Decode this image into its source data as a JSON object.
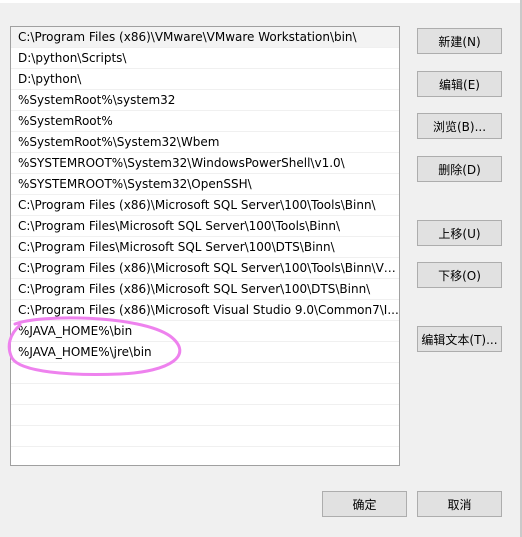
{
  "path_list": {
    "entries": [
      "C:\\Program Files (x86)\\VMware\\VMware Workstation\\bin\\",
      "D:\\python\\Scripts\\",
      "D:\\python\\",
      "%SystemRoot%\\system32",
      "%SystemRoot%",
      "%SystemRoot%\\System32\\Wbem",
      "%SYSTEMROOT%\\System32\\WindowsPowerShell\\v1.0\\",
      "%SYSTEMROOT%\\System32\\OpenSSH\\",
      "C:\\Program Files (x86)\\Microsoft SQL Server\\100\\Tools\\Binn\\",
      "C:\\Program Files\\Microsoft SQL Server\\100\\Tools\\Binn\\",
      "C:\\Program Files\\Microsoft SQL Server\\100\\DTS\\Binn\\",
      "C:\\Program Files (x86)\\Microsoft SQL Server\\100\\Tools\\Binn\\VS...",
      "C:\\Program Files (x86)\\Microsoft SQL Server\\100\\DTS\\Binn\\",
      "C:\\Program Files (x86)\\Microsoft Visual Studio 9.0\\Common7\\I...",
      "%JAVA_HOME%\\bin",
      "%JAVA_HOME%\\jre\\bin"
    ]
  },
  "actions": {
    "new": "新建(N)",
    "edit": "编辑(E)",
    "browse": "浏览(B)...",
    "delete": "删除(D)",
    "move_up": "上移(U)",
    "move_down": "下移(O)",
    "edit_text": "编辑文本(T)..."
  },
  "footer": {
    "ok": "确定",
    "cancel": "取消"
  },
  "colors": {
    "annotation": "#ee82ee"
  }
}
